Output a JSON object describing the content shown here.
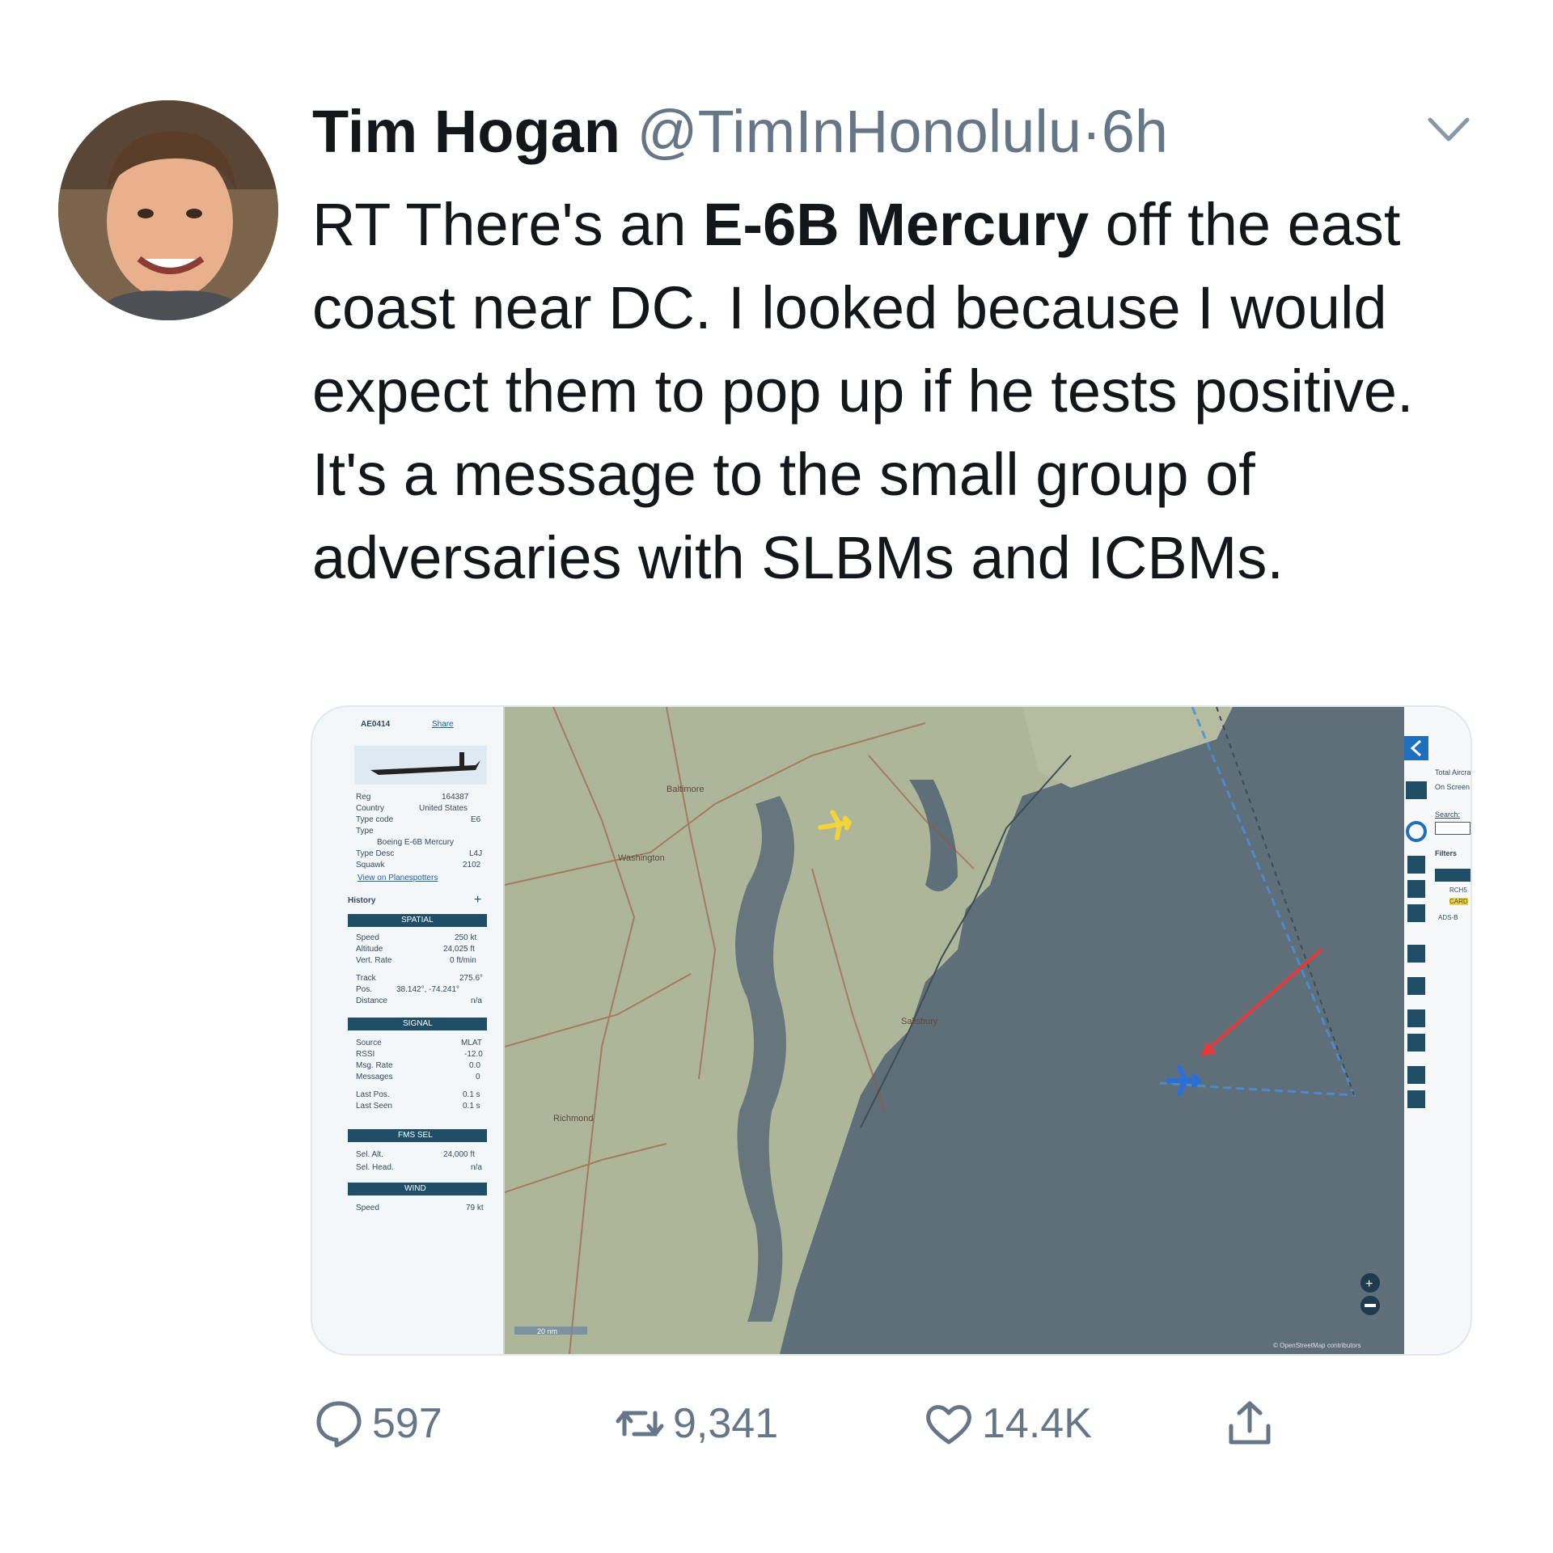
{
  "tweet": {
    "author_name": "Tim Hogan",
    "handle": "@TimInHonolulu",
    "separator": "·",
    "time": "6h",
    "text_1": "RT There's an ",
    "text_bold": "E-6B Mercury",
    "text_2": " off the east coast near DC.  I looked because I would expect them to pop up if he tests positive.  It's a message to the small group of adversaries  with SLBMs and ICBMs."
  },
  "media": {
    "panel": {
      "callsign": "AE0414",
      "share": "Share",
      "reg_label": "Reg",
      "reg_value": "164387",
      "country_label": "Country",
      "country_value": "United States",
      "typecode_label": "Type code",
      "typecode_value": "E6",
      "type_label": "Type",
      "type_value": "Boeing E-6B Mercury",
      "typedesc_label": "Type Desc",
      "typedesc_value": "L4J",
      "squawk_label": "Squawk",
      "squawk_value": "2102",
      "link": "View on Planespotters",
      "history": "History",
      "spatial": "SPATIAL",
      "speed_label": "Speed",
      "speed_value": "250 kt",
      "alt_label": "Altitude",
      "alt_value": "24,025 ft",
      "vrate_label": "Vert. Rate",
      "vrate_value": "0 ft/min",
      "track_label": "Track",
      "track_value": "275.6°",
      "pos_label": "Pos.",
      "pos_value": "38.142°, -74.241°",
      "dist_label": "Distance",
      "dist_value": "n/a",
      "signal": "SIGNAL",
      "source_label": "Source",
      "source_value": "MLAT",
      "rssi_label": "RSSI",
      "rssi_value": "-12.0",
      "msgrate_label": "Msg. Rate",
      "msgrate_value": "0.0",
      "messages_label": "Messages",
      "messages_value": "0",
      "lastpos_label": "Last Pos.",
      "lastpos_value": "0.1 s",
      "lastseen_label": "Last Seen",
      "lastseen_value": "0.1 s",
      "fms": "FMS SEL",
      "selalt_label": "Sel. Alt.",
      "selalt_value": "24,000 ft",
      "selhead_label": "Sel. Head.",
      "selhead_value": "n/a",
      "wind": "WIND",
      "wspeed_label": "Speed",
      "wspeed_value": "79 kt"
    },
    "map": {
      "scale": "20 nm",
      "attribution": "© OpenStreetMap contributors",
      "labels": {
        "washington": "Washington",
        "baltimore": "Baltimore",
        "richmond": "Richmond",
        "salisbury": "Salisbury"
      }
    },
    "right_panel": {
      "total": "Total Aircraft",
      "on_screen": "On Screen",
      "search": "Search:",
      "filters": "Filters",
      "f1": "RCH5",
      "f2": "CARD",
      "adsb": "ADS-B"
    }
  },
  "actions": {
    "reply_count": "597",
    "retweet_count": "9,341",
    "like_count": "14.4K"
  },
  "colors": {
    "text": "#14171a",
    "muted": "#657786",
    "ocean": "#5e6f79",
    "land": "#aeb69a",
    "highlight_plane": "#f2d43a",
    "selected_plane": "#2a6fd6",
    "arrow": "#e03a3a"
  },
  "icons": [
    "chevron-down-icon",
    "reply-icon",
    "retweet-icon",
    "heart-icon",
    "share-icon",
    "airplane-icon"
  ]
}
